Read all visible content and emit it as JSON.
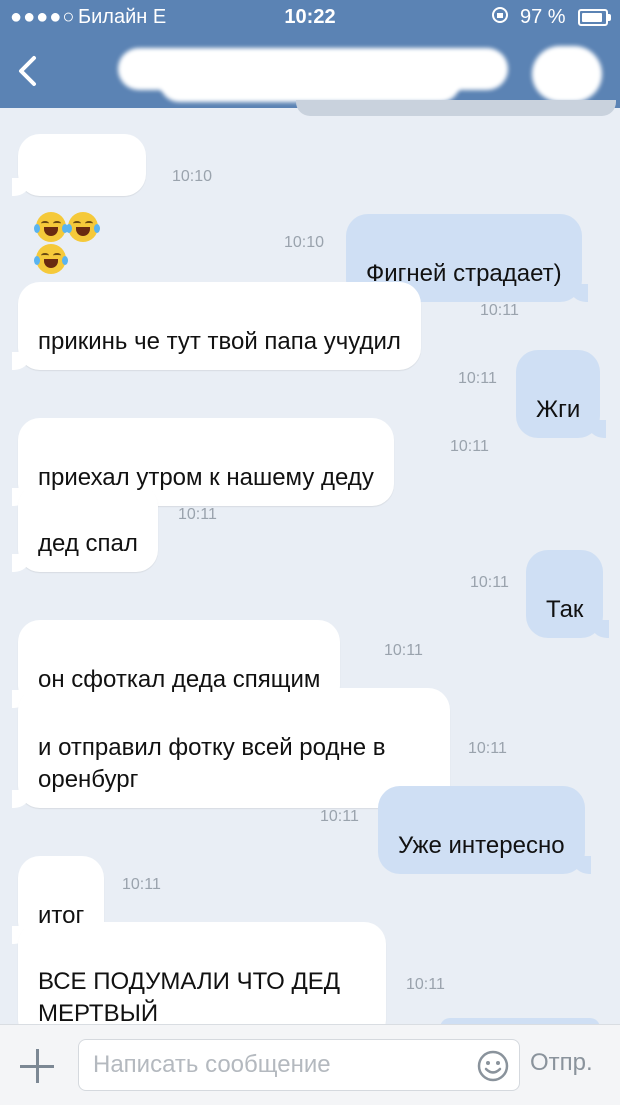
{
  "status_bar": {
    "signal": "●●●●○",
    "carrier": "Билайн  E",
    "time": "10:22",
    "rotation_lock_icon": "rotation-lock-icon",
    "battery": "97 %",
    "battery_level_percent": 97
  },
  "nav": {
    "back_icon": "chevron-left-icon"
  },
  "messages": [
    {
      "side": "in",
      "emoji": [
        "face-with-tears-of-joy",
        "face-with-tears-of-joy",
        "face-with-tears-of-joy"
      ],
      "time": "10:10"
    },
    {
      "side": "out",
      "text": "Фигней страдает)",
      "time": "10:10"
    },
    {
      "side": "in",
      "text": "прикинь че тут твой папа учудил",
      "time": "10:11"
    },
    {
      "side": "out",
      "text": "Жги",
      "time": "10:11"
    },
    {
      "side": "in",
      "text": "приехал утром к нашему деду",
      "time": "10:11"
    },
    {
      "side": "in",
      "text": "дед спал",
      "time": "10:11"
    },
    {
      "side": "out",
      "text": "Так",
      "time": "10:11"
    },
    {
      "side": "in",
      "text": "он сфоткал деда спящим",
      "time": "10:11"
    },
    {
      "side": "in",
      "text": "и отправил фотку всей родне в\nоренбург",
      "time": "10:11"
    },
    {
      "side": "out",
      "text": "Уже интересно",
      "time": "10:11"
    },
    {
      "side": "in",
      "text": "итог",
      "time": "10:11"
    },
    {
      "side": "in",
      "text": "ВСЕ ПОДУМАЛИ ЧТО ДЕД\nМЕРТВЫЙ",
      "time": "10:11"
    }
  ],
  "input_bar": {
    "attach_icon": "plus-icon",
    "placeholder": "Написать сообщение",
    "emoji_icon": "smiley-icon",
    "send_label": "Отпр."
  },
  "colors": {
    "header": "#5b83b4",
    "background": "#e9eef5",
    "incoming_bubble": "#ffffff",
    "outgoing_bubble": "#cfdff4",
    "timestamp": "#9aa3ad"
  }
}
